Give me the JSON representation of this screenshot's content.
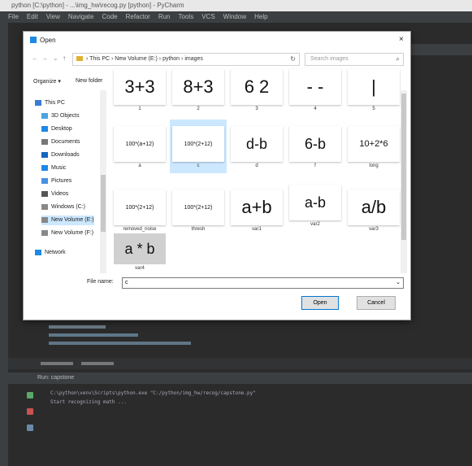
{
  "ide": {
    "title": "python [C:\\python] - ...\\img_hw\\recog.py [python] - PyCharm",
    "menu": [
      "File",
      "Edit",
      "View",
      "Navigate",
      "Code",
      "Refactor",
      "Run",
      "Tools",
      "VCS",
      "Window",
      "Help"
    ],
    "run_tab": "Run: capstone",
    "console_lines": [
      "C:\\python\\venv\\Scripts\\python.exe \"C:/python/img_hw/recog/capstone.py\"",
      "   Start recognizing math ..."
    ]
  },
  "dialog": {
    "title": "Open",
    "close_glyph": "×",
    "breadcrumb": [
      "This PC",
      "New Volume (E:)",
      "python",
      "images"
    ],
    "search_placeholder": "Search images",
    "organize_label": "Organize ▾",
    "new_folder_label": "New folder",
    "nav_items": [
      {
        "label": "This PC",
        "icon": "pc-icon",
        "color": "#3a7bd5"
      },
      {
        "label": "3D Objects",
        "icon": "cube-icon",
        "color": "#4aa3df"
      },
      {
        "label": "Desktop",
        "icon": "desktop-icon",
        "color": "#1e88e5"
      },
      {
        "label": "Documents",
        "icon": "document-icon",
        "color": "#777777"
      },
      {
        "label": "Downloads",
        "icon": "download-icon",
        "color": "#1565c0"
      },
      {
        "label": "Music",
        "icon": "music-icon",
        "color": "#1e88e5"
      },
      {
        "label": "Pictures",
        "icon": "picture-icon",
        "color": "#4a90e2"
      },
      {
        "label": "Videos",
        "icon": "video-icon",
        "color": "#555555"
      },
      {
        "label": "Windows (C:)",
        "icon": "drive-icon",
        "color": "#888888"
      },
      {
        "label": "New Volume (E:)",
        "icon": "drive-icon",
        "color": "#888888"
      },
      {
        "label": "New Volume (F:)",
        "icon": "drive-icon",
        "color": "#888888"
      },
      {
        "label": "Network",
        "icon": "network-icon",
        "color": "#1e88e5"
      }
    ],
    "files": [
      {
        "name": "1",
        "thumb_text": "3+3"
      },
      {
        "name": "2",
        "thumb_text": "8+3"
      },
      {
        "name": "3",
        "thumb_text": "6 2"
      },
      {
        "name": "4",
        "thumb_text": "- -"
      },
      {
        "name": "5",
        "thumb_text": "|"
      },
      {
        "name": "a",
        "thumb_text": "100*(a+12)"
      },
      {
        "name": "c",
        "thumb_text": "100*(2+12)"
      },
      {
        "name": "d",
        "thumb_text": "d-b"
      },
      {
        "name": "f",
        "thumb_text": "6-b"
      },
      {
        "name": "long",
        "thumb_text": "10+2*6"
      },
      {
        "name": "removed_noise",
        "thumb_text": "100*(2+12)"
      },
      {
        "name": "thresh",
        "thumb_text": "100*(2+12)"
      },
      {
        "name": "var1",
        "thumb_text": "a+b"
      },
      {
        "name": "var2",
        "thumb_text": "a-b"
      },
      {
        "name": "var3",
        "thumb_text": "a/b"
      },
      {
        "name": "var4",
        "thumb_text": "a * b"
      }
    ],
    "filename_label": "File name:",
    "filename_value": "c",
    "open_label": "Open",
    "cancel_label": "Cancel"
  }
}
